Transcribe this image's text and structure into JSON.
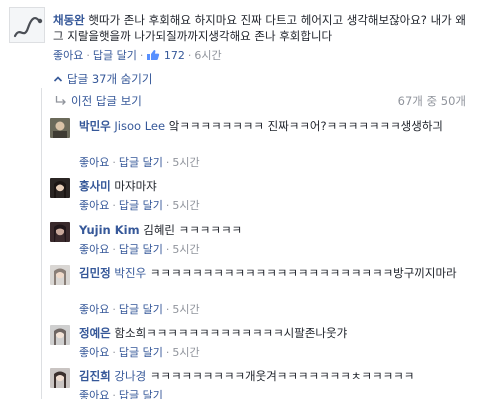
{
  "top_comment": {
    "author": "채동완",
    "text": "햇따가 존나 후회해요 하지마요 진짜 다트고 헤어지고 생각해보잖아요? 내가 왜 그 지랄을햇을까 나가되질까까지생각해요 존나 후회합니다",
    "like_label": "좋아요",
    "reply_label": "답글 달기",
    "like_count": "172",
    "time": "6시간"
  },
  "hide_replies_label": "답글 37개 숨기기",
  "previous_replies": {
    "label": "이전 답글 보기",
    "count": "67개 중 50개"
  },
  "replies": [
    {
      "author": "박민우",
      "mention": "Jisoo Lee",
      "text": "앜ㅋㅋㅋㅋㅋㅋㅋㅋ 진짜ㅋㅋ어?ㅋㅋㅋㅋㅋㅋㅋ생생하긔",
      "like_label": "좋아요",
      "reply_label": "답글 달기",
      "time": "5시간"
    },
    {
      "author": "홍사미",
      "mention": "",
      "text": "마쟈마쟈",
      "like_label": "좋아요",
      "reply_label": "답글 달기",
      "time": "5시간"
    },
    {
      "author": "Yujin Kim",
      "mention": "",
      "text": "김혜린 ㅋㅋㅋㅋㅋㅋ",
      "like_label": "좋아요",
      "reply_label": "답글 달기",
      "time": "5시간"
    },
    {
      "author": "김민정",
      "mention": "박진우",
      "text": "ㅋㅋㅋㅋㅋㅋㅋㅋㅋㅋㅋㅋㅋㅋㅋㅋㅋㅋㅋㅋㅋㅋㅋ방구끼지마라",
      "like_label": "좋아요",
      "reply_label": "답글 달기",
      "time": "5시간"
    },
    {
      "author": "정예은",
      "mention": "",
      "text": "함소희ㅋㅋㅋㅋㅋㅋㅋㅋㅋㅋㅋㅋㅋ시팔존나웃갸",
      "like_label": "좋아요",
      "reply_label": "답글 달기",
      "time": "5시간"
    },
    {
      "author": "김진희",
      "mention": "강나경",
      "text": "ㅋㅋㅋㅋㅋㅋㅋㅋㅋ개웃겨ㅋㅋㅋㅋㅋㅋㅋㅊㅋㅋㅋㅋㅋ",
      "like_label": "좋아요",
      "reply_label": "답글 달기",
      "time": ""
    }
  ],
  "colors": {
    "link": "#365899",
    "meta": "#90949c",
    "text": "#1d2129",
    "divider": "#dddfe2",
    "like_badge": "#5890ff"
  },
  "icons": [
    "reply-arrow-icon",
    "chevron-up-icon",
    "thumbs-up-icon"
  ]
}
